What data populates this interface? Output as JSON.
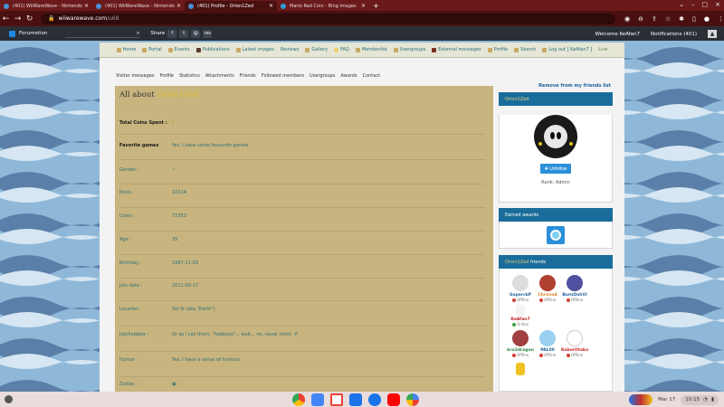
{
  "browser": {
    "tabs": [
      {
        "title": "(401) WiiWareWave - Nintendo",
        "active": false
      },
      {
        "title": "(401) WiiWareWave - Nintendo",
        "active": false
      },
      {
        "title": "(401) Profile - Orion1Zed",
        "active": true
      },
      {
        "title": "Mario Red Coin - Bing images",
        "active": false
      }
    ],
    "url_host": "wiiwarewave.com",
    "url_path": "/u68"
  },
  "forumotion_bar": {
    "logo": "Forumotion",
    "share_label": "Share",
    "share_icons": [
      "f",
      "t",
      "@",
      "rss"
    ],
    "welcome": "Welcome KeAfan7",
    "notifications": "Notifications (401)"
  },
  "forum_nav": {
    "items": [
      "Home",
      "Portal",
      "Events",
      "Publications",
      "Latest images",
      "Reviews",
      "Gallery",
      "FAQ",
      "Memberlist",
      "Usergroups",
      "External messages",
      "Profile",
      "Search",
      "Log out [ KeAfan7 ]"
    ],
    "live": "Live"
  },
  "profile_tabs": [
    "Visitor messages",
    "Profile",
    "Statistics",
    "Attachments",
    "Friends",
    "Followed members",
    "Usergroups",
    "Awards",
    "Contact"
  ],
  "remove_friend": "Remove from my friends list",
  "about": {
    "title_prefix": "All about ",
    "username": "Orion1Zed",
    "fields": [
      {
        "label": "Total Coins Spent :",
        "value": "1"
      },
      {
        "label": "Favorite games",
        "value": "Yes, I have some favourite games."
      },
      {
        "label": "Gender :",
        "value": "✓"
      },
      {
        "label": "Posts :",
        "value": "10214"
      },
      {
        "label": "Coins :",
        "value": "72353"
      },
      {
        "label": "Age :",
        "value": "35"
      },
      {
        "label": "Birthday :",
        "value": "1987-11-03"
      },
      {
        "label": "Join date :",
        "value": "2011-09-17"
      },
      {
        "label": "Location :",
        "value": "Sol III (aka \"Earth\")"
      },
      {
        "label": "Job/hobbies :",
        "value": "Or as I call them, \"hobbyes\"... wait... no, never mind. :P"
      },
      {
        "label": "Humor :",
        "value": "Yes, I have a sense of humour."
      },
      {
        "label": "Zodiac :",
        "value": "▣"
      }
    ]
  },
  "sidebar": {
    "profile_box": {
      "title": "Orion1Zed",
      "unfollow": "✚ Unfollow",
      "rank": "Rank: Admin"
    },
    "awards_box": {
      "title": "Earned awards"
    },
    "friends_box": {
      "title_name": "Orion1Zed",
      "title_suffix": " friends",
      "friends": [
        {
          "name": "SuperckP",
          "status": "Offline",
          "color": "#1d5f9a",
          "avatar": "#dcdcdc"
        },
        {
          "name": "Chrono4",
          "status": "Offline",
          "color": "#e08020",
          "avatar": "#b04030"
        },
        {
          "name": "BurnDuhVI",
          "status": "Offline",
          "color": "#1d5f9a",
          "avatar": "#5050a0"
        },
        {
          "name": "KeAfan7",
          "status": "Online",
          "color": "#c02020",
          "avatar": "#f3f3f3"
        },
        {
          "name": "bro2dragon",
          "status": "Offline",
          "color": "#2a8040",
          "avatar": "#a04040"
        },
        {
          "name": "PAL00",
          "status": "Offline",
          "color": "#1d5f9a",
          "avatar": "#9ad0f0"
        },
        {
          "name": "KoborOtaku",
          "status": "Offline",
          "color": "#c02020",
          "avatar": "#ffffff"
        }
      ]
    }
  },
  "shelf": {
    "date": "Mar 17",
    "time": "10:15"
  }
}
